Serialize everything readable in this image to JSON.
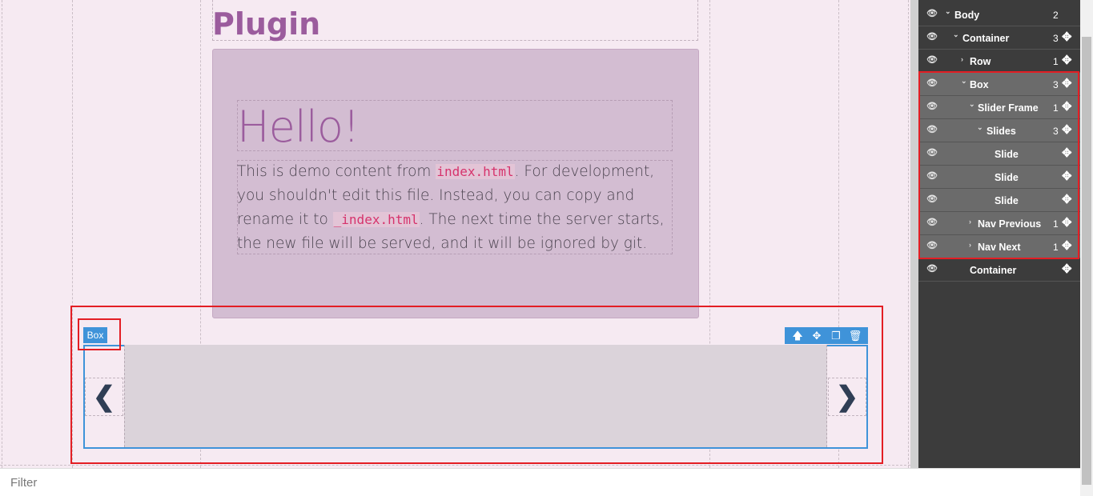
{
  "canvas": {
    "page_title": "Plugin",
    "hello": "Hello!",
    "paragraph": {
      "p1": "This is demo content from ",
      "code1": "index.html",
      "p2": ". For development, you shouldn't edit this file. Instead, you can copy and rename it to ",
      "code2": "_index.html",
      "p3": ". The next time the server starts, the new file will be served, and it will be ignored by git."
    },
    "box_badge": "Box",
    "nav_prev_glyph": "❮",
    "nav_next_glyph": "❯"
  },
  "box_tools": {
    "up": "🡅",
    "move": "✥",
    "clone": "❐",
    "delete": "🗑"
  },
  "layers": [
    {
      "name": "Body",
      "count": "2",
      "expanded": "yes"
    },
    {
      "name": "Container",
      "count": "3",
      "expanded": "yes"
    },
    {
      "name": "Row",
      "count": "1",
      "expanded": "no"
    },
    {
      "name": "Box",
      "count": "3",
      "expanded": "yes"
    },
    {
      "name": "Slider Frame",
      "count": "1",
      "expanded": "yes"
    },
    {
      "name": "Slides",
      "count": "3",
      "expanded": "yes"
    },
    {
      "name": "Slide",
      "count": "",
      "expanded": "none"
    },
    {
      "name": "Slide",
      "count": "",
      "expanded": "none"
    },
    {
      "name": "Slide",
      "count": "",
      "expanded": "none"
    },
    {
      "name": "Nav Previous",
      "count": "1",
      "expanded": "no"
    },
    {
      "name": "Nav Next",
      "count": "1",
      "expanded": "no"
    },
    {
      "name": "Container",
      "count": "",
      "expanded": "none"
    }
  ],
  "icons": {
    "eye": "eye-icon",
    "move": "move-icon",
    "chevron_down": "chevron-down-icon",
    "chevron_right": "chevron-right-icon"
  },
  "filter": {
    "placeholder": "Filter",
    "value": ""
  },
  "colors": {
    "canvas_bg": "#f6eaf2",
    "title": "#9b5c9d",
    "selection_blue": "#3f93d9",
    "annotation_red": "#e31e24",
    "panel_bg": "#3c3c3c",
    "panel_highlight": "#6b6b6b"
  }
}
